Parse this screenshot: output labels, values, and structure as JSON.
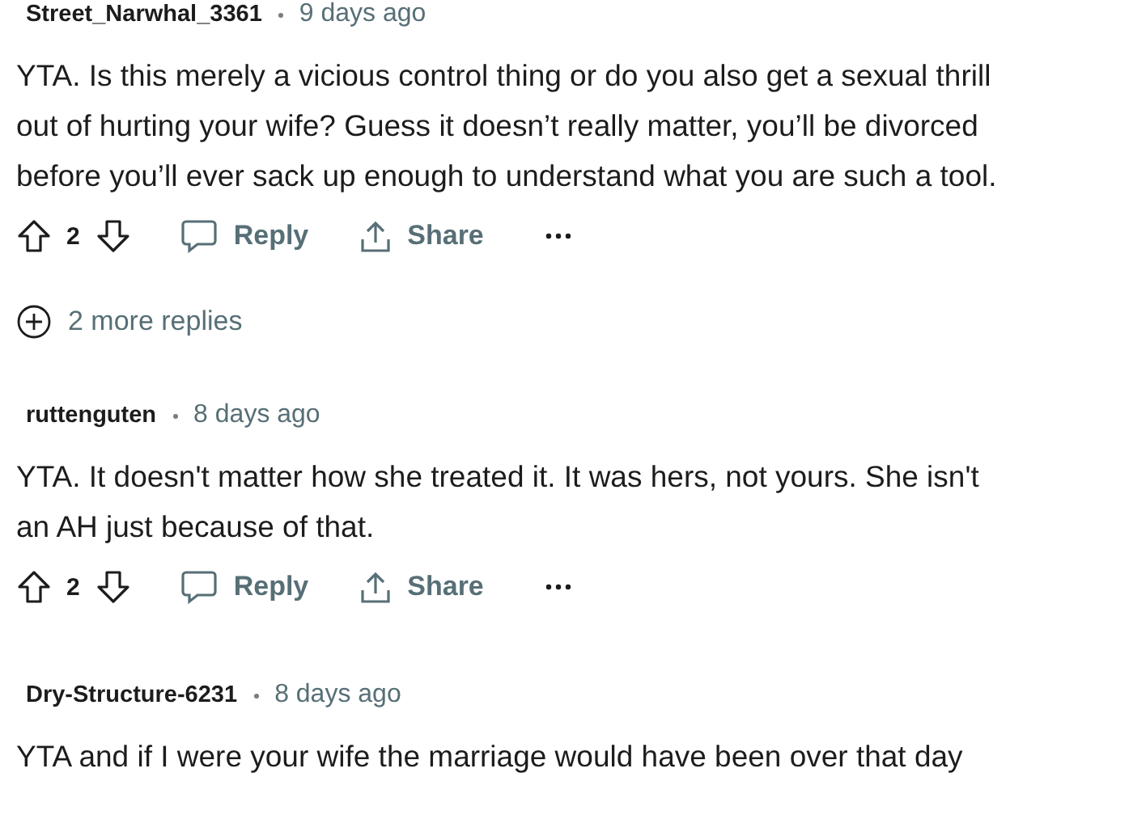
{
  "comments": [
    {
      "author": "Street_Narwhal_3361",
      "age": "9 days ago",
      "body": [
        "YTA. Is this merely a vicious control thing or do you also get a sexual thrill",
        "out of hurting your wife? Guess it doesn’t really matter, you’ll be divorced",
        "before you’ll ever sack up enough to understand what you are such a tool."
      ],
      "votes": "2",
      "reply": "Reply",
      "share": "Share",
      "more_replies": "2 more replies"
    },
    {
      "author": "ruttenguten",
      "age": "8 days ago",
      "body": [
        "YTA. It doesn't matter how she treated it. It was hers, not yours. She isn't",
        "an AH just because of that."
      ],
      "votes": "2",
      "reply": "Reply",
      "share": "Share"
    },
    {
      "author": "Dry-Structure-6231",
      "age": "8 days ago",
      "body": [
        "YTA and if I were your wife the marriage would have been over that day"
      ]
    }
  ]
}
